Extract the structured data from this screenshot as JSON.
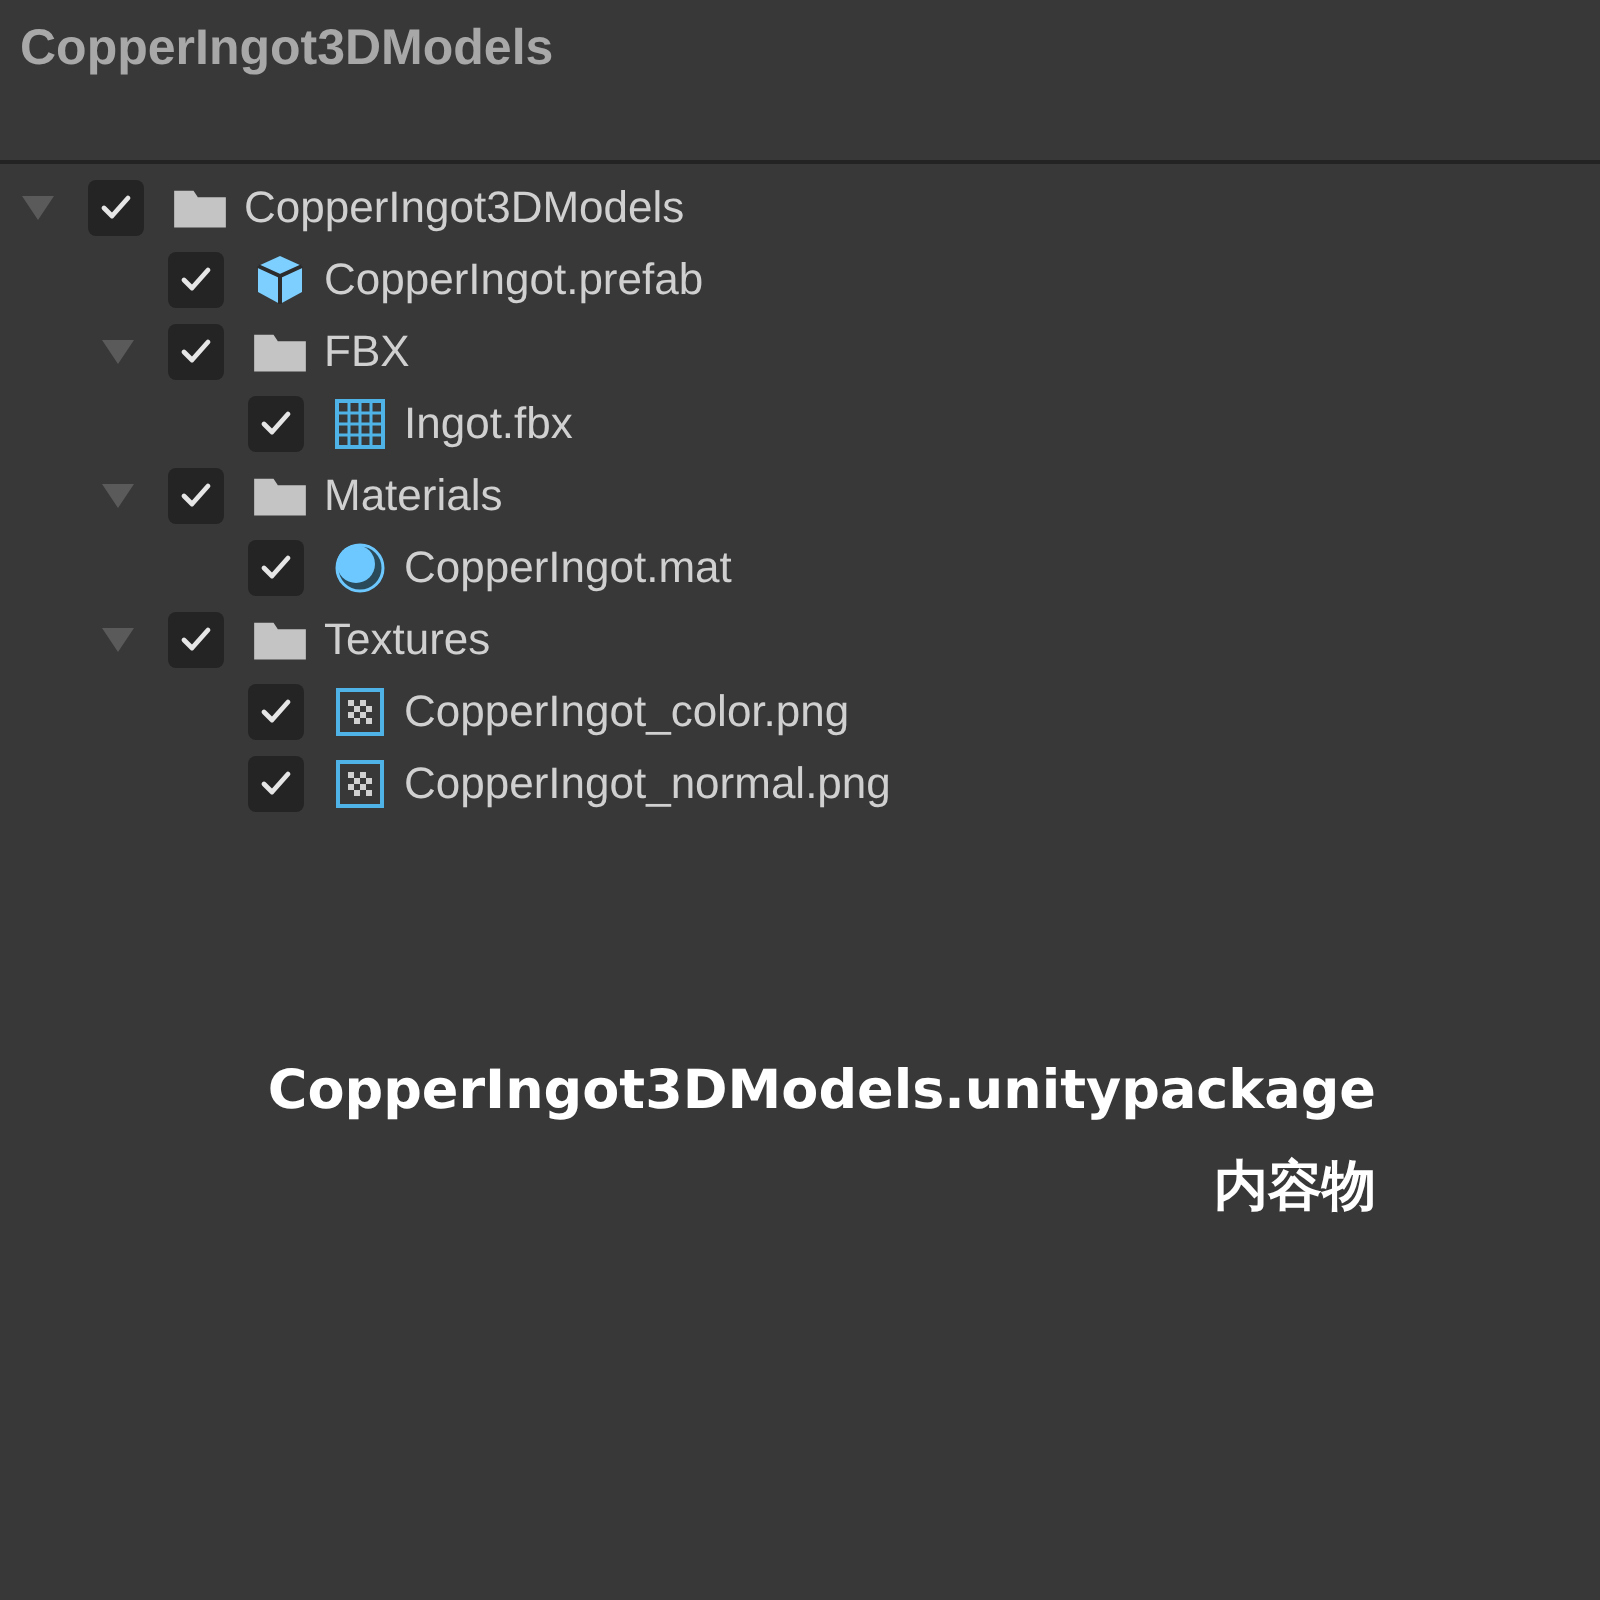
{
  "window": {
    "title": "CopperIngot3DModels"
  },
  "tree": [
    {
      "label": "CopperIngot3DModels",
      "kind": "folder",
      "checked": true,
      "expanded": true,
      "children": [
        {
          "label": "CopperIngot.prefab",
          "kind": "prefab",
          "checked": true
        },
        {
          "label": "FBX",
          "kind": "folder",
          "checked": true,
          "expanded": true,
          "children": [
            {
              "label": "Ingot.fbx",
              "kind": "model",
              "checked": true
            }
          ]
        },
        {
          "label": "Materials",
          "kind": "folder",
          "checked": true,
          "expanded": true,
          "children": [
            {
              "label": "CopperIngot.mat",
              "kind": "material",
              "checked": true
            }
          ]
        },
        {
          "label": "Textures",
          "kind": "folder",
          "checked": true,
          "expanded": true,
          "children": [
            {
              "label": "CopperIngot_color.png",
              "kind": "texture",
              "checked": true
            },
            {
              "label": "CopperIngot_normal.png",
              "kind": "texture",
              "checked": true
            }
          ]
        }
      ]
    }
  ],
  "caption": [
    "CopperIngot3DModels.unitypackage",
    "内容物"
  ]
}
